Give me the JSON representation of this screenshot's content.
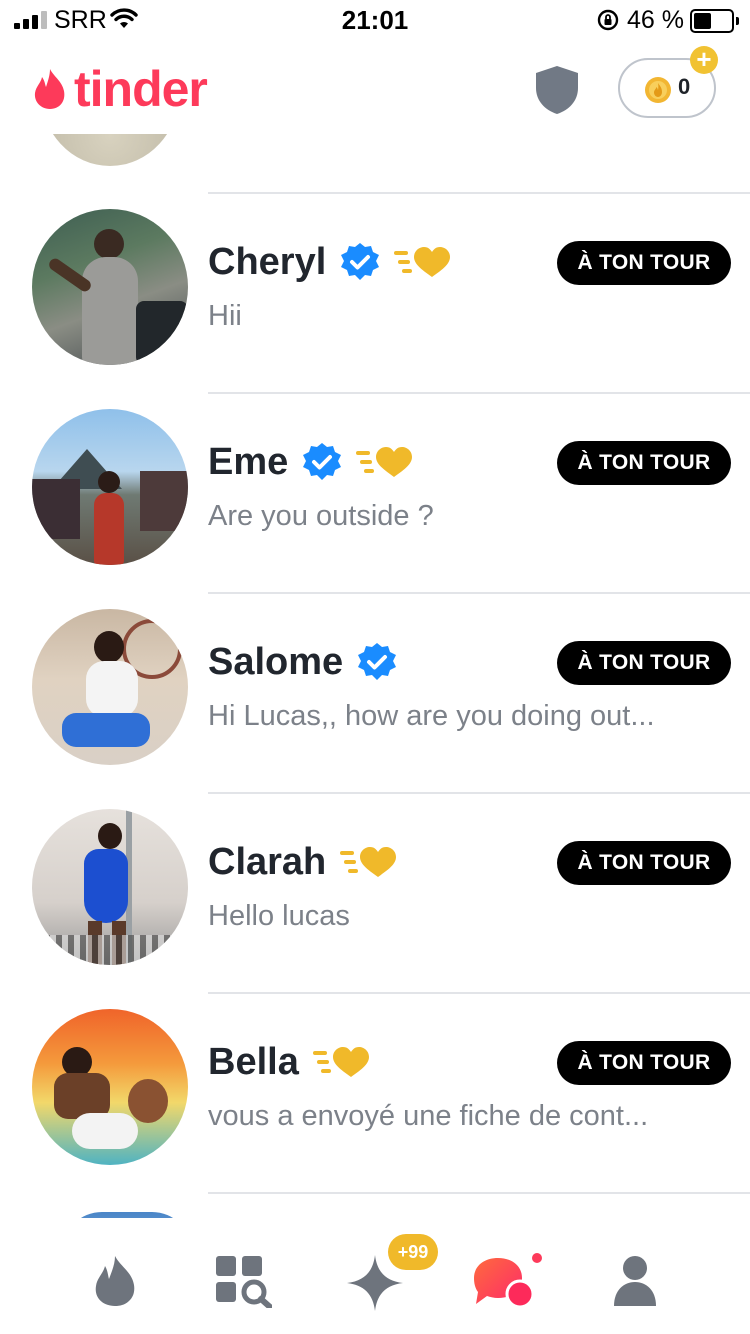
{
  "status_bar": {
    "carrier": "SRR",
    "time": "21:01",
    "battery_percent": "46 %",
    "battery_level": 0.46
  },
  "header": {
    "brand": "tinder",
    "coin_count": "0"
  },
  "conversations": [
    {
      "name": "Cheryl",
      "verified": true,
      "super_like": true,
      "message": "Hii",
      "badge": "À TON TOUR"
    },
    {
      "name": "Eme",
      "verified": true,
      "super_like": true,
      "message": "Are you outside ?",
      "badge": "À TON TOUR"
    },
    {
      "name": "Salome",
      "verified": true,
      "super_like": false,
      "message": "Hi Lucas,, how are you doing out...",
      "badge": "À TON TOUR"
    },
    {
      "name": "Clarah",
      "verified": false,
      "super_like": true,
      "message": "Hello lucas",
      "badge": "À TON TOUR"
    },
    {
      "name": "Bella",
      "verified": false,
      "super_like": true,
      "message": "vous a envoyé une fiche de cont...",
      "badge": "À TON TOUR"
    }
  ],
  "tab_bar": {
    "items": [
      {
        "icon": "flame-icon",
        "active": false
      },
      {
        "icon": "explore-icon",
        "active": false
      },
      {
        "icon": "sparkle-icon",
        "active": false
      },
      {
        "icon": "chat-bubbles-icon",
        "active": true
      },
      {
        "icon": "profile-icon",
        "active": false
      }
    ],
    "likes_badge": "+99"
  },
  "colors": {
    "brand": "#fd3a5a",
    "verified": "#1a8cff",
    "gold": "#f0b92a",
    "badge_bg": "#000000",
    "inactive_icon": "#6e747d"
  }
}
